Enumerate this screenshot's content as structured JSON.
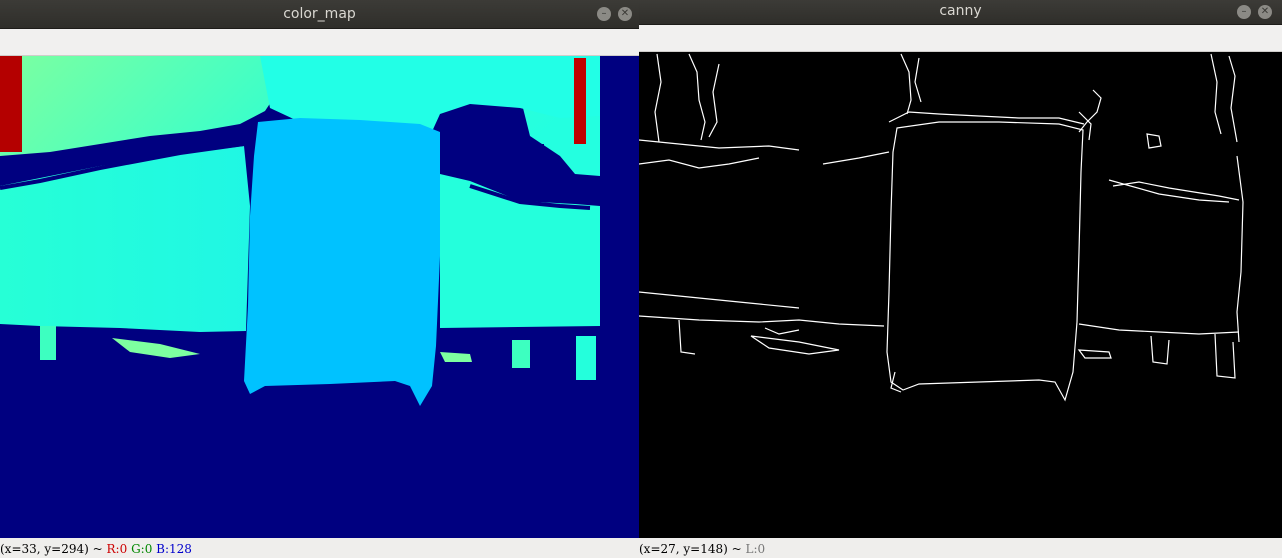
{
  "left_window": {
    "title": "color_map",
    "buttons": {
      "minimize": "–",
      "close": "✕"
    },
    "status": {
      "coords": "(x=33, y=294)",
      "sep": " ~ ",
      "r": "R:0",
      "g": "G:0",
      "b": "B:128"
    }
  },
  "right_window": {
    "title": "canny",
    "buttons": {
      "minimize": "–",
      "close": "✕"
    },
    "status": {
      "coords": "(x=27, y=148)",
      "sep": " ~ ",
      "l": "L:0"
    }
  },
  "colors": {
    "jet_background": "#000080",
    "jet_cyan": "#24ffd9",
    "jet_blue": "#00c3ff",
    "jet_green": "#80ff80",
    "jet_red": "#b40000",
    "canny_background": "#000000",
    "canny_edges": "#ffffff"
  }
}
